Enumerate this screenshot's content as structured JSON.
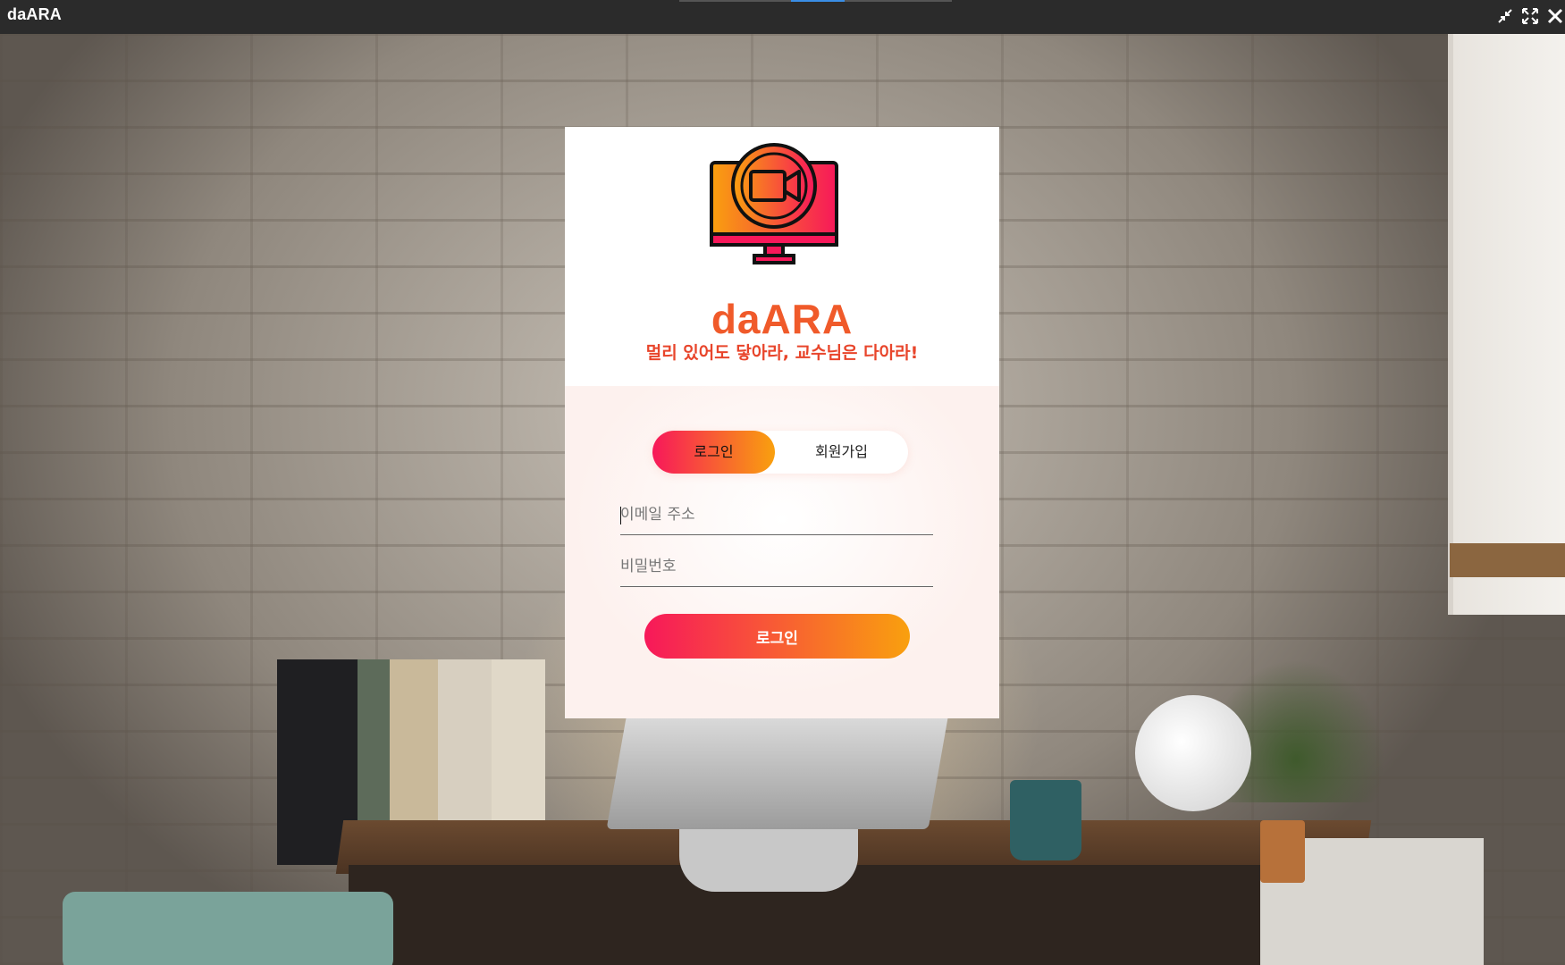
{
  "window": {
    "title": "daARA",
    "controls": [
      "minimize-icon",
      "maximize-icon",
      "close-icon"
    ]
  },
  "brand": {
    "name": "daARA",
    "slogan": "멀리 있어도 닿아라, 교수님은 다아라!",
    "logo_icon": "monitor-video-camera-icon"
  },
  "tabs": [
    {
      "label": "로그인",
      "active": true
    },
    {
      "label": "회원가입",
      "active": false
    }
  ],
  "form": {
    "email_placeholder": "이메일 주소",
    "password_placeholder": "비밀번호",
    "submit_label": "로그인"
  },
  "colors": {
    "gradient_start": "#f7185a",
    "gradient_end": "#f9a00e",
    "brand_orange": "#f05a2a",
    "titlebar": "#2b2b2b"
  }
}
